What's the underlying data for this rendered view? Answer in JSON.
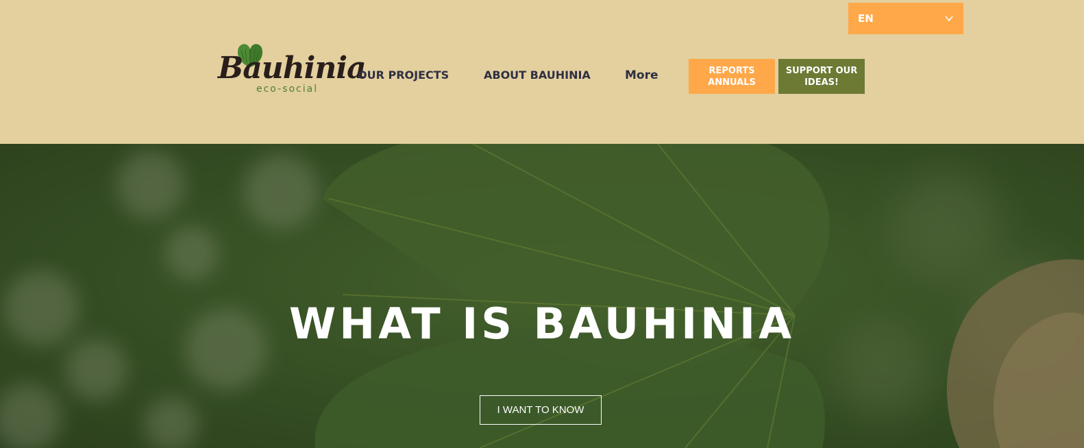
{
  "language": {
    "selected": "EN",
    "icon": "chevron-down-icon"
  },
  "logo": {
    "wordmark": "Bauhinia",
    "tagline": "eco-social",
    "icon": "bauhinia-leaf-icon"
  },
  "nav": {
    "items": [
      {
        "label": "OUR PROJECTS"
      },
      {
        "label": "ABOUT BAUHINIA"
      },
      {
        "label": "More"
      }
    ]
  },
  "buttons": {
    "reports_line1": "REPORTS",
    "reports_line2": "ANNUALS",
    "support_line1": "SUPPORT OUR",
    "support_line2": "IDEAS!"
  },
  "hero": {
    "title": "WHAT IS BAUHINIA",
    "cta": "I WANT TO KNOW"
  },
  "colors": {
    "header_bg": "#e3d09e",
    "accent_orange": "#ffa84a",
    "accent_olive": "#6c7a34",
    "nav_text": "#2f2f44",
    "logo_green": "#4e7f32"
  }
}
